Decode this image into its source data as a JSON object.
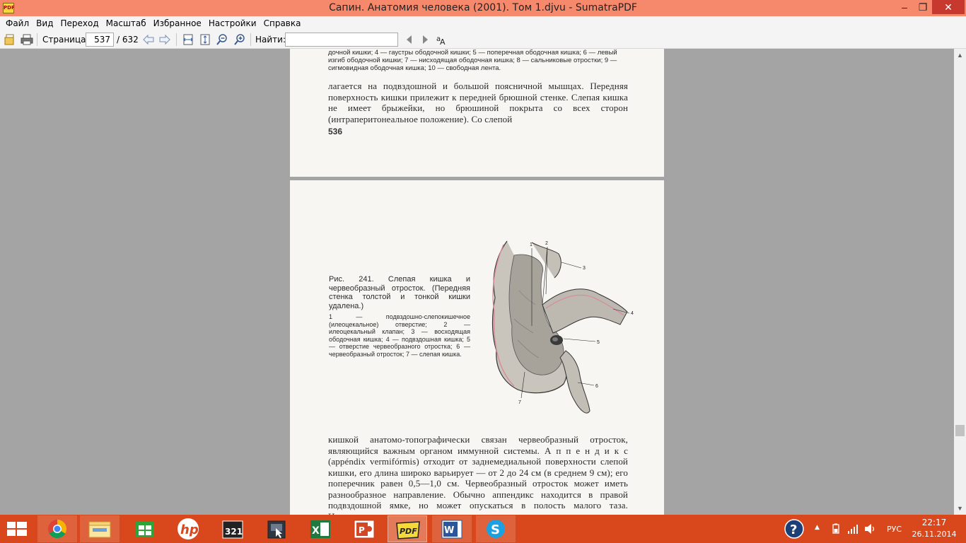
{
  "window": {
    "title": "Сапин. Анатомия человека (2001). Том 1.djvu - SumatraPDF",
    "app_icon_text": "PDF"
  },
  "menu": [
    "Файл",
    "Вид",
    "Переход",
    "Масштаб",
    "Избранное",
    "Настройки",
    "Справка"
  ],
  "toolbar": {
    "page_label": "Страница:",
    "page_value": "537",
    "page_total": "/ 632",
    "find_label": "Найти:",
    "find_value": ""
  },
  "page_top": {
    "caption": "дочной кишки; 4 — гаустры ободочной кишки; 5 — поперечная ободочная кишка; 6 — левый изгиб ободочной кишки; 7 — нисходящая ободочная кишка; 8 — сальниковые отростки; 9 — сигмовидная ободочная кишка; 10 — свободная лента.",
    "body": "лагается на подвздошной и большой поясничной мышцах. Передняя поверхность кишки прилежит к передней брюшной стенке. Слепая кишка не имеет брыжейки, но брюшиной покрыта со всех сторон (интраперитонеальное положение). Со слепой",
    "page_number": "536"
  },
  "page_bottom": {
    "fig_title": "Рис. 241. Слепая кишка и червеобразный отросток. (Передняя стенка толстой и тонкой кишки удалена.)",
    "fig_legend": "1 — подвздошно-слепокишечное (илеоцекальное) отверстие; 2 — илеоцекальный клапан; 3 — восходящая ободочная кишка; 4 — подвздошная кишка; 5 — отверстие червеобразного отростка; 6 — червеобразный отросток; 7 — слепая кишка.",
    "fig_labels": [
      "1",
      "2",
      "3",
      "4",
      "5",
      "6",
      "7"
    ],
    "body": "кишкой анатомо-топографически связан червеобразный отросток, являющийся важным органом иммунной системы. А п п е н д и к с (appéndix vermifórmis) отходит от заднемедиальной поверхности слепой кишки, его длина широко варьирует — от 2 до 24 см (в среднем 9 см); его поперечник равен 0,5—1,0 см. Червеобразный отросток может иметь разнообразное направление. Обычно аппендикс находится в правой подвздошной ямке, но может опускаться в полость малого таза. Направление аппен-"
  },
  "taskbar": {
    "apps": [
      "chrome",
      "file-explorer",
      "store",
      "hp",
      "media-player-classic",
      "screen-tool",
      "excel",
      "powerpoint",
      "sumatrapdf",
      "word",
      "skype"
    ],
    "active_app": "sumatrapdf",
    "tray_lang": "РУС",
    "time": "22:17",
    "date": "26.11.2014"
  },
  "colors": {
    "title_bar": "#f6896c",
    "taskbar": "#d9481c",
    "viewer_bg": "#a4a4a4",
    "close_button": "#c7382e"
  }
}
